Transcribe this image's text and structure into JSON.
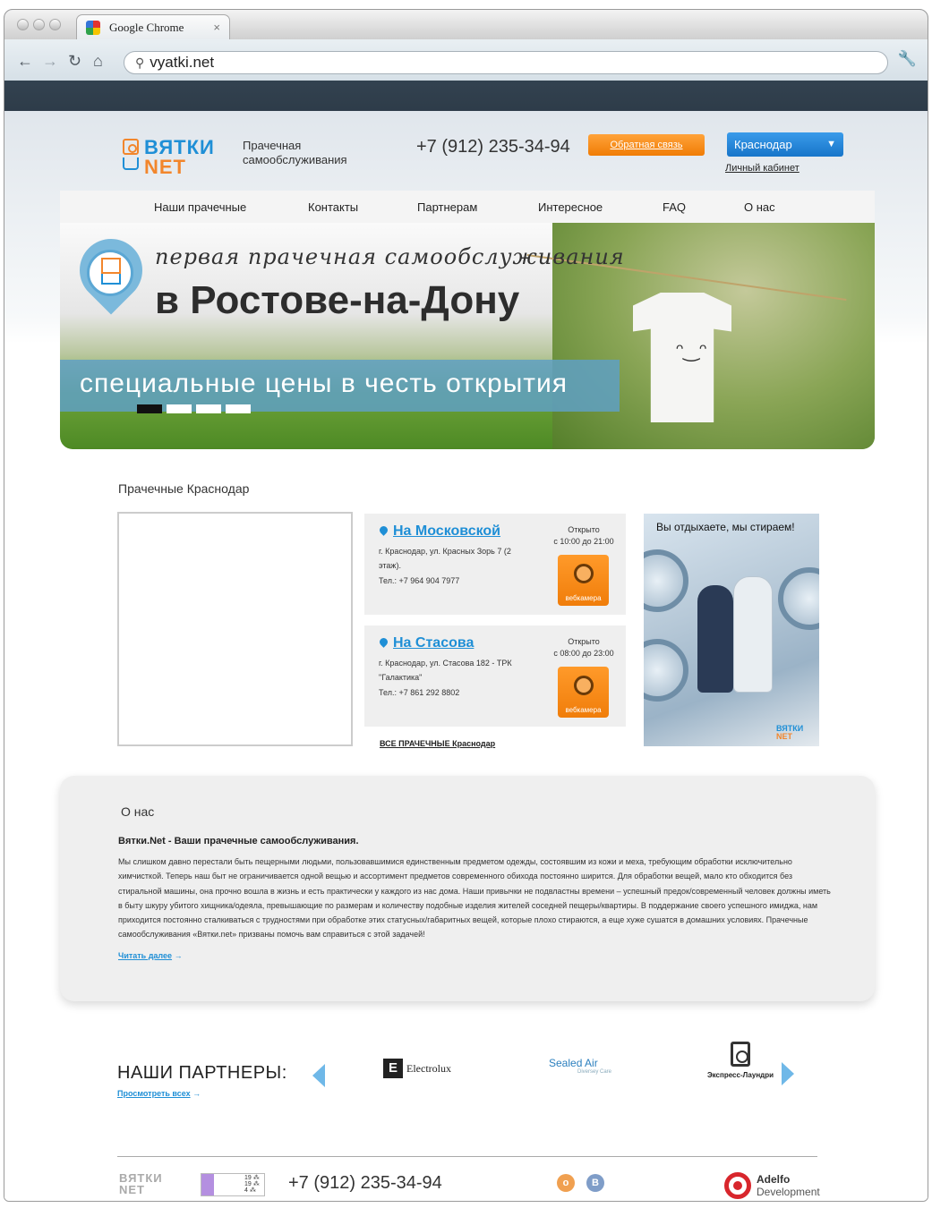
{
  "browser": {
    "tab_title": "Google Chrome",
    "tab_close": "×",
    "url": "vyatki.net",
    "nav_back": "←",
    "nav_forward": "→",
    "nav_reload": "↻",
    "nav_home": "⌂",
    "search_icon": "⚲",
    "wrench_icon": "🔧"
  },
  "header": {
    "logo_line1": "ВЯТКИ",
    "logo_line2": "NET",
    "tagline": "Прачечная самообслуживания",
    "phone": "+7 (912) 235-34-94",
    "callback_label": "Обратная связь",
    "city": "Краснодар",
    "city_arrow": "▼",
    "cabinet": "Личный кабинет"
  },
  "menu": [
    {
      "label": "Наши прачечные"
    },
    {
      "label": "Контакты"
    },
    {
      "label": "Партнерам"
    },
    {
      "label": "Интересное"
    },
    {
      "label": "FAQ"
    },
    {
      "label": "О нас"
    }
  ],
  "banner": {
    "line1": "первая прачечная самообслуживания",
    "line2": "в Ростове-на-Дону",
    "strip": "специальные цены в честь открытия",
    "face": "ᵔ‿ᵔ",
    "slides": 4,
    "active_slide": 1
  },
  "laundries": {
    "section_title": "Прачечные Краснодар",
    "items": [
      {
        "name": "На Московской",
        "address": "г. Краснодар, ул. Красных Зорь 7 (2 этаж).",
        "tel": "Тел.: +7 964 904 7977",
        "open_label": "Открыто",
        "hours": "с 10:00 до 21:00",
        "cam_label": "вебкамера"
      },
      {
        "name": "На Стасова",
        "address": "г. Краснодар, ул. Стасова 182 - ТРК \"Галактика\"",
        "tel": "Тел.: +7 861 292 8802",
        "open_label": "Открыто",
        "hours": "с 08:00 до 23:00",
        "cam_label": "вебкамера"
      }
    ],
    "all_link": "ВСЕ ПРАЧЕЧНЫЕ Краснодар",
    "promo_text": "Вы отдыхаете, мы стираем!",
    "promo_logo1": "ВЯТКИ",
    "promo_logo2": "NET"
  },
  "about": {
    "title": "О нас",
    "subtitle": "Вятки.Net - Ваши прачечные самообслуживания.",
    "text": "Мы слишком давно перестали быть пещерными людьми, пользовавшимися единственным предметом одежды, состоявшим из кожи и меха, требующим обработки исключительно химчисткой. Теперь наш быт не ограничивается одной вещью и ассортимент предметов современного обихода постоянно ширится. Для обработки вещей, мало кто обходится без стиральной машины, она прочно вошла в жизнь и есть практически у каждого из нас дома. Наши привычки не подвластны времени – успешный предок/современный человек должны иметь в быту шкуру убитого хищника/одеяла, превышающие по размерам и количеству подобные изделия жителей соседней пещеры/квартиры. В поддержание своего успешного имиджа, нам приходится постоянно сталкиваться с трудностями при обработке этих статусных/габаритных вещей, которые плохо стираются, а еще хуже сушатся в домашних условиях. Прачечные самообслуживания «Вятки.net» призваны помочь вам справиться с этой задачей!",
    "read_more": "Читать далее",
    "read_more_arrow": "→"
  },
  "partners": {
    "title": "НАШИ ПАРТНЕРЫ:",
    "view_all": "Просмотреть всех",
    "view_all_arrow": "→",
    "items": [
      {
        "name": "Electrolux",
        "mark": "E"
      },
      {
        "name": "Sealed Air",
        "sub": "Diversey Care"
      },
      {
        "name": "Экспресс-Лаундри"
      }
    ]
  },
  "footer": {
    "logo_line1": "ВЯТКИ",
    "logo_line2": "NET",
    "counter": "19 ⁂ 19 ⁂ 4 ⁂",
    "phone": "+7 (912) 235-34-94",
    "social": [
      {
        "label": "о",
        "color": "#f0a050"
      },
      {
        "label": "В",
        "color": "#7f9dc8"
      }
    ],
    "dev_line1": "Adelfo",
    "dev_line2": "Development"
  }
}
